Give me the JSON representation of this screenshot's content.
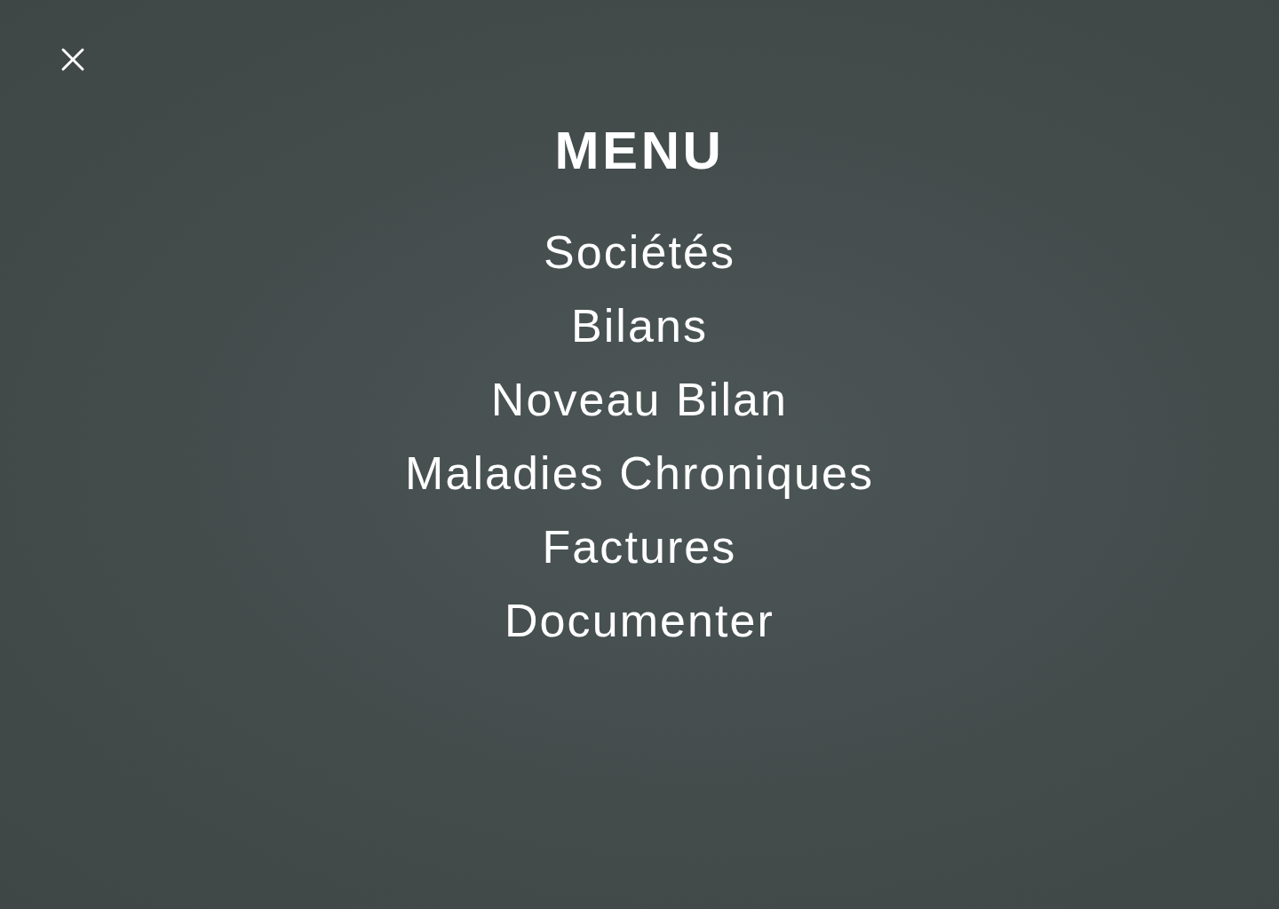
{
  "menu": {
    "title": "MENU",
    "items": [
      {
        "label": "Sociétés"
      },
      {
        "label": "Bilans"
      },
      {
        "label": "Noveau Bilan"
      },
      {
        "label": "Maladies Chroniques"
      },
      {
        "label": "Factures"
      },
      {
        "label": "Documenter"
      }
    ]
  }
}
